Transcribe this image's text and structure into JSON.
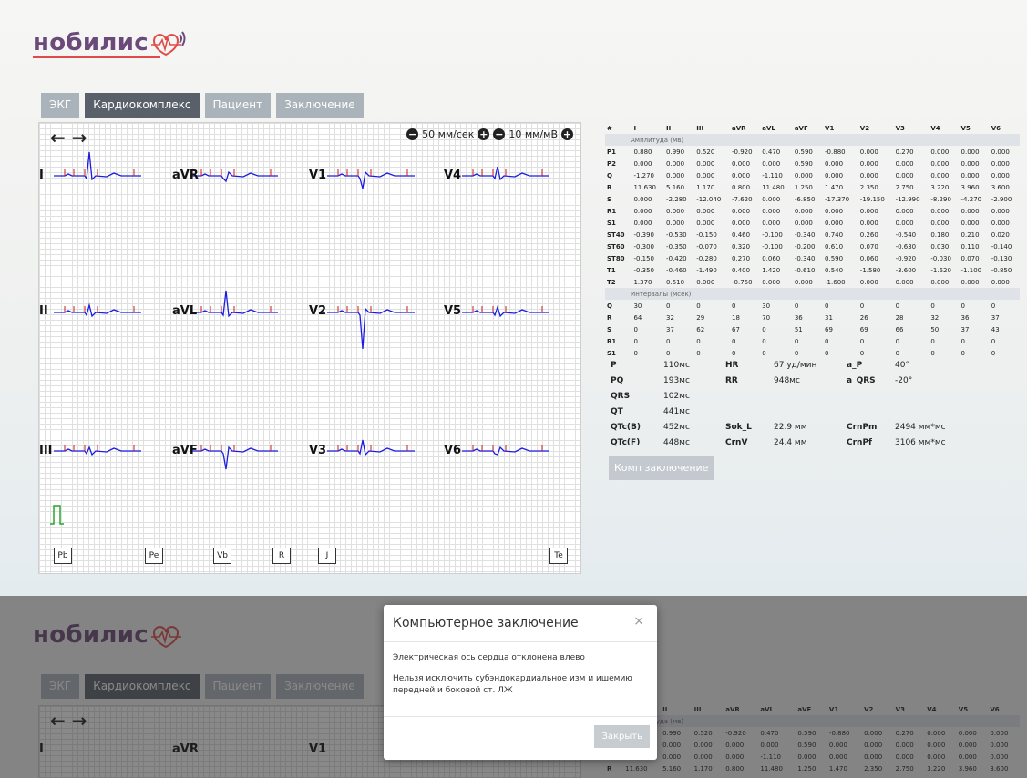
{
  "logo": {
    "text": "нобилис"
  },
  "tabs": [
    {
      "label": "ЭКГ",
      "active": false
    },
    {
      "label": "Кардиокомплекс",
      "active": true
    },
    {
      "label": "Пациент",
      "active": false
    },
    {
      "label": "Заключение",
      "active": false
    }
  ],
  "ecg_view": {
    "speed": "50 мм/сек",
    "gain": "10 мм/мВ",
    "leads": [
      "I",
      "aVR",
      "V1",
      "V4",
      "II",
      "aVL",
      "V2",
      "V5",
      "III",
      "aVF",
      "V3",
      "V6"
    ],
    "markers": [
      "Pb",
      "Pe",
      "Vb",
      "R",
      "J",
      "Te"
    ]
  },
  "amplitude_table": {
    "headers": [
      "#",
      "I",
      "II",
      "III",
      "aVR",
      "aVL",
      "aVF",
      "V1",
      "V2",
      "V3",
      "V4",
      "V5",
      "V6"
    ],
    "section_amplitude": "Амплитуда (мв)",
    "amp_rows": [
      [
        "P1",
        "0.880",
        "0.990",
        "0.520",
        "-0.920",
        "0.470",
        "0.590",
        "-0.880",
        "0.000",
        "0.270",
        "0.000",
        "0.000",
        "0.000"
      ],
      [
        "P2",
        "0.000",
        "0.000",
        "0.000",
        "0.000",
        "0.000",
        "0.590",
        "0.000",
        "0.000",
        "0.000",
        "0.000",
        "0.000",
        "0.000"
      ],
      [
        "Q",
        "-1.270",
        "0.000",
        "0.000",
        "0.000",
        "-1.110",
        "0.000",
        "0.000",
        "0.000",
        "0.000",
        "0.000",
        "0.000",
        "0.000"
      ],
      [
        "R",
        "11.630",
        "5.160",
        "1.170",
        "0.800",
        "11.480",
        "1.250",
        "1.470",
        "2.350",
        "2.750",
        "3.220",
        "3.960",
        "3.600"
      ],
      [
        "S",
        "0.000",
        "-2.280",
        "-12.040",
        "-7.620",
        "0.000",
        "-6.850",
        "-17.370",
        "-19.150",
        "-12.990",
        "-8.290",
        "-4.270",
        "-2.900"
      ],
      [
        "R1",
        "0.000",
        "0.000",
        "0.000",
        "0.000",
        "0.000",
        "0.000",
        "0.000",
        "0.000",
        "0.000",
        "0.000",
        "0.000",
        "0.000"
      ],
      [
        "S1",
        "0.000",
        "0.000",
        "0.000",
        "0.000",
        "0.000",
        "0.000",
        "0.000",
        "0.000",
        "0.000",
        "0.000",
        "0.000",
        "0.000"
      ],
      [
        "ST40",
        "-0.390",
        "-0.530",
        "-0.150",
        "0.460",
        "-0.100",
        "-0.340",
        "0.740",
        "0.260",
        "-0.540",
        "0.180",
        "0.210",
        "0.020"
      ],
      [
        "ST60",
        "-0.300",
        "-0.350",
        "-0.070",
        "0.320",
        "-0.100",
        "-0.200",
        "0.610",
        "0.070",
        "-0.630",
        "0.030",
        "0.110",
        "-0.140"
      ],
      [
        "ST80",
        "-0.150",
        "-0.420",
        "-0.280",
        "0.270",
        "0.060",
        "-0.340",
        "0.590",
        "0.060",
        "-0.920",
        "-0.030",
        "0.070",
        "-0.130"
      ],
      [
        "T1",
        "-0.350",
        "-0.460",
        "-1.490",
        "0.400",
        "1.420",
        "-0.610",
        "0.540",
        "-1.580",
        "-3.600",
        "-1.620",
        "-1.100",
        "-0.850"
      ],
      [
        "T2",
        "1.370",
        "0.510",
        "0.000",
        "-0.750",
        "0.000",
        "0.000",
        "-1.600",
        "0.000",
        "0.000",
        "0.000",
        "0.000",
        "0.000"
      ]
    ],
    "section_intervals": "Интервалы (мсек)",
    "int_rows": [
      [
        "Q",
        "30",
        "0",
        "0",
        "0",
        "30",
        "0",
        "0",
        "0",
        "0",
        "0",
        "0",
        "0"
      ],
      [
        "R",
        "64",
        "32",
        "29",
        "18",
        "70",
        "36",
        "31",
        "26",
        "28",
        "32",
        "36",
        "37"
      ],
      [
        "S",
        "0",
        "37",
        "62",
        "67",
        "0",
        "51",
        "69",
        "69",
        "66",
        "50",
        "37",
        "43"
      ],
      [
        "R1",
        "0",
        "0",
        "0",
        "0",
        "0",
        "0",
        "0",
        "0",
        "0",
        "0",
        "0",
        "0"
      ],
      [
        "S1",
        "0",
        "0",
        "0",
        "0",
        "0",
        "0",
        "0",
        "0",
        "0",
        "0",
        "0",
        "0"
      ]
    ]
  },
  "params": {
    "rows": [
      {
        "l1": "P",
        "v1": "110мс",
        "l2": "HR",
        "v2": "67 уд/мин",
        "l3": "a_P",
        "v3": "40°"
      },
      {
        "l1": "PQ",
        "v1": "193мс",
        "l2": "RR",
        "v2": "948мс",
        "l3": "a_QRS",
        "v3": "-20°"
      },
      {
        "l1": "QRS",
        "v1": "102мс",
        "l2": "",
        "v2": "",
        "l3": "",
        "v3": ""
      },
      {
        "l1": "QT",
        "v1": "441мс",
        "l2": "",
        "v2": "",
        "l3": "",
        "v3": ""
      },
      {
        "l1": "QTc(B)",
        "v1": "452мс",
        "l2": "Sok_L",
        "v2": "22.9 мм",
        "l3": "CrnPm",
        "v3": "2494 мм*мс"
      },
      {
        "l1": "QTc(F)",
        "v1": "448мс",
        "l2": "CrnV",
        "v2": "24.4 мм",
        "l3": "CrnPf",
        "v3": "3106 мм*мс"
      }
    ]
  },
  "comp_button": "Комп заключение",
  "modal": {
    "title": "Компьютерное заключение",
    "close": "×",
    "line1": "Электрическая ось сердца отклонена влево",
    "line2": "Нельзя исключить субэндокардиальное изм и ишемию передней и боковой ст. ЛЖ",
    "button": "Закрыть"
  },
  "colors": {
    "trace": "#1c1ce0",
    "marker_tick": "#c81e1e",
    "calibration": "#2aa52a",
    "active_tab": "#59606a",
    "inactive_tab": "#aab2ba"
  }
}
